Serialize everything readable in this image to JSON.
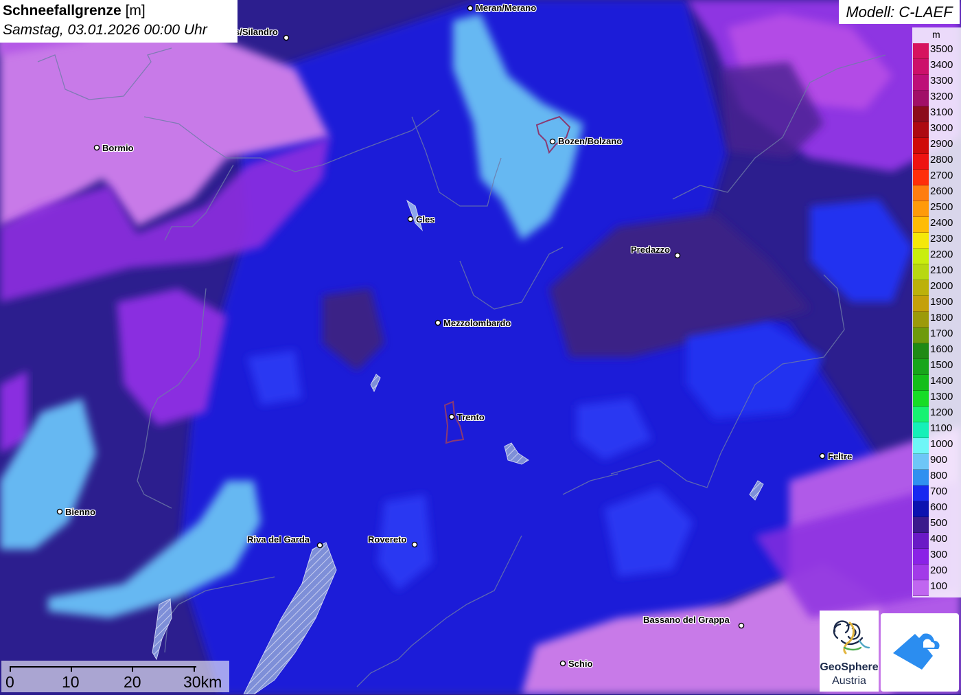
{
  "title": {
    "main": "Schneefallgrenze",
    "unit": "[m]",
    "datetime": "Samstag, 03.01.2026 00:00 Uhr"
  },
  "model": "Modell: C-LAEF",
  "legend": {
    "unit": "m",
    "items": [
      {
        "label": "3500",
        "color": "#d6135f"
      },
      {
        "label": "3400",
        "color": "#cc106a"
      },
      {
        "label": "3300",
        "color": "#bd0f78"
      },
      {
        "label": "3200",
        "color": "#a11068"
      },
      {
        "label": "3100",
        "color": "#8c0c1c"
      },
      {
        "label": "3000",
        "color": "#ad0a12"
      },
      {
        "label": "2900",
        "color": "#cf0a0a"
      },
      {
        "label": "2800",
        "color": "#ee1212"
      },
      {
        "label": "2700",
        "color": "#ff2e0a"
      },
      {
        "label": "2600",
        "color": "#ff7d10"
      },
      {
        "label": "2500",
        "color": "#ff9a0a"
      },
      {
        "label": "2400",
        "color": "#ffbc05"
      },
      {
        "label": "2300",
        "color": "#f5e80a"
      },
      {
        "label": "2200",
        "color": "#c9ee0d"
      },
      {
        "label": "2100",
        "color": "#b8d811"
      },
      {
        "label": "2000",
        "color": "#bcb10b"
      },
      {
        "label": "1900",
        "color": "#c4a00b"
      },
      {
        "label": "1800",
        "color": "#9c9a0a"
      },
      {
        "label": "1700",
        "color": "#6e9a0c"
      },
      {
        "label": "1600",
        "color": "#1f8a15"
      },
      {
        "label": "1500",
        "color": "#18a51b"
      },
      {
        "label": "1400",
        "color": "#14be1a"
      },
      {
        "label": "1300",
        "color": "#17dc26"
      },
      {
        "label": "1200",
        "color": "#17f272"
      },
      {
        "label": "1100",
        "color": "#15f0b8"
      },
      {
        "label": "1000",
        "color": "#6ff6f7"
      },
      {
        "label": "900",
        "color": "#6ec6f7"
      },
      {
        "label": "800",
        "color": "#3090f0"
      },
      {
        "label": "700",
        "color": "#1828f0"
      },
      {
        "label": "600",
        "color": "#0c12b0"
      },
      {
        "label": "500",
        "color": "#3a1a8c"
      },
      {
        "label": "400",
        "color": "#6a1ac6"
      },
      {
        "label": "300",
        "color": "#8a22e6"
      },
      {
        "label": "200",
        "color": "#a23ae8"
      },
      {
        "label": "100",
        "color": "#c066f0"
      }
    ]
  },
  "cities": [
    {
      "name": "Meran/Merano"
    },
    {
      "name": "s/Silandro"
    },
    {
      "name": "Bormio"
    },
    {
      "name": "Bozen/Bolzano"
    },
    {
      "name": "Cles"
    },
    {
      "name": "Predazzo"
    },
    {
      "name": "Mezzolombardo"
    },
    {
      "name": "Trento"
    },
    {
      "name": "Feltre"
    },
    {
      "name": "Bienno"
    },
    {
      "name": "Riva del Garda"
    },
    {
      "name": "Rovereto"
    },
    {
      "name": "Bassano del Grappa"
    },
    {
      "name": "Schio"
    }
  ],
  "scalebar": {
    "labels": [
      "0",
      "10",
      "20",
      "30km"
    ]
  },
  "logos": {
    "geosphere": {
      "line1": "GeoSphere",
      "line2": "Austria"
    }
  }
}
